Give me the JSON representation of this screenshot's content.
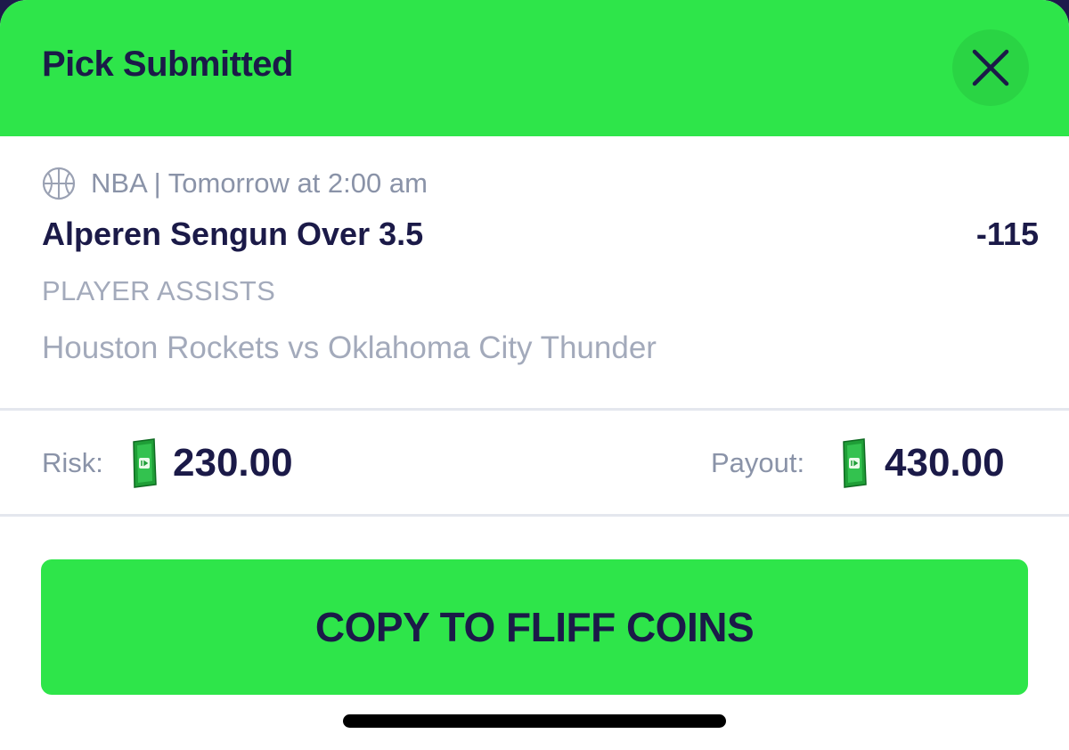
{
  "header": {
    "title": "Pick Submitted",
    "close_icon": "close-icon"
  },
  "pick": {
    "sport_icon": "basketball-icon",
    "meta": "NBA | Tomorrow at 2:00 am",
    "selection": "Alperen Sengun Over 3.5",
    "odds": "-115",
    "market": "PLAYER ASSISTS",
    "matchup": "Houston Rockets vs Oklahoma City Thunder"
  },
  "wager": {
    "risk_label": "Risk:",
    "risk_amount": "230.00",
    "payout_label": "Payout:",
    "payout_amount": "430.00",
    "currency_icon": "cash-bill-icon"
  },
  "action": {
    "copy_label": "COPY TO FLIFF COINS"
  },
  "colors": {
    "accent_green": "#2ee54a",
    "navy_text": "#1b1a48",
    "muted_text": "#8a93a8"
  }
}
